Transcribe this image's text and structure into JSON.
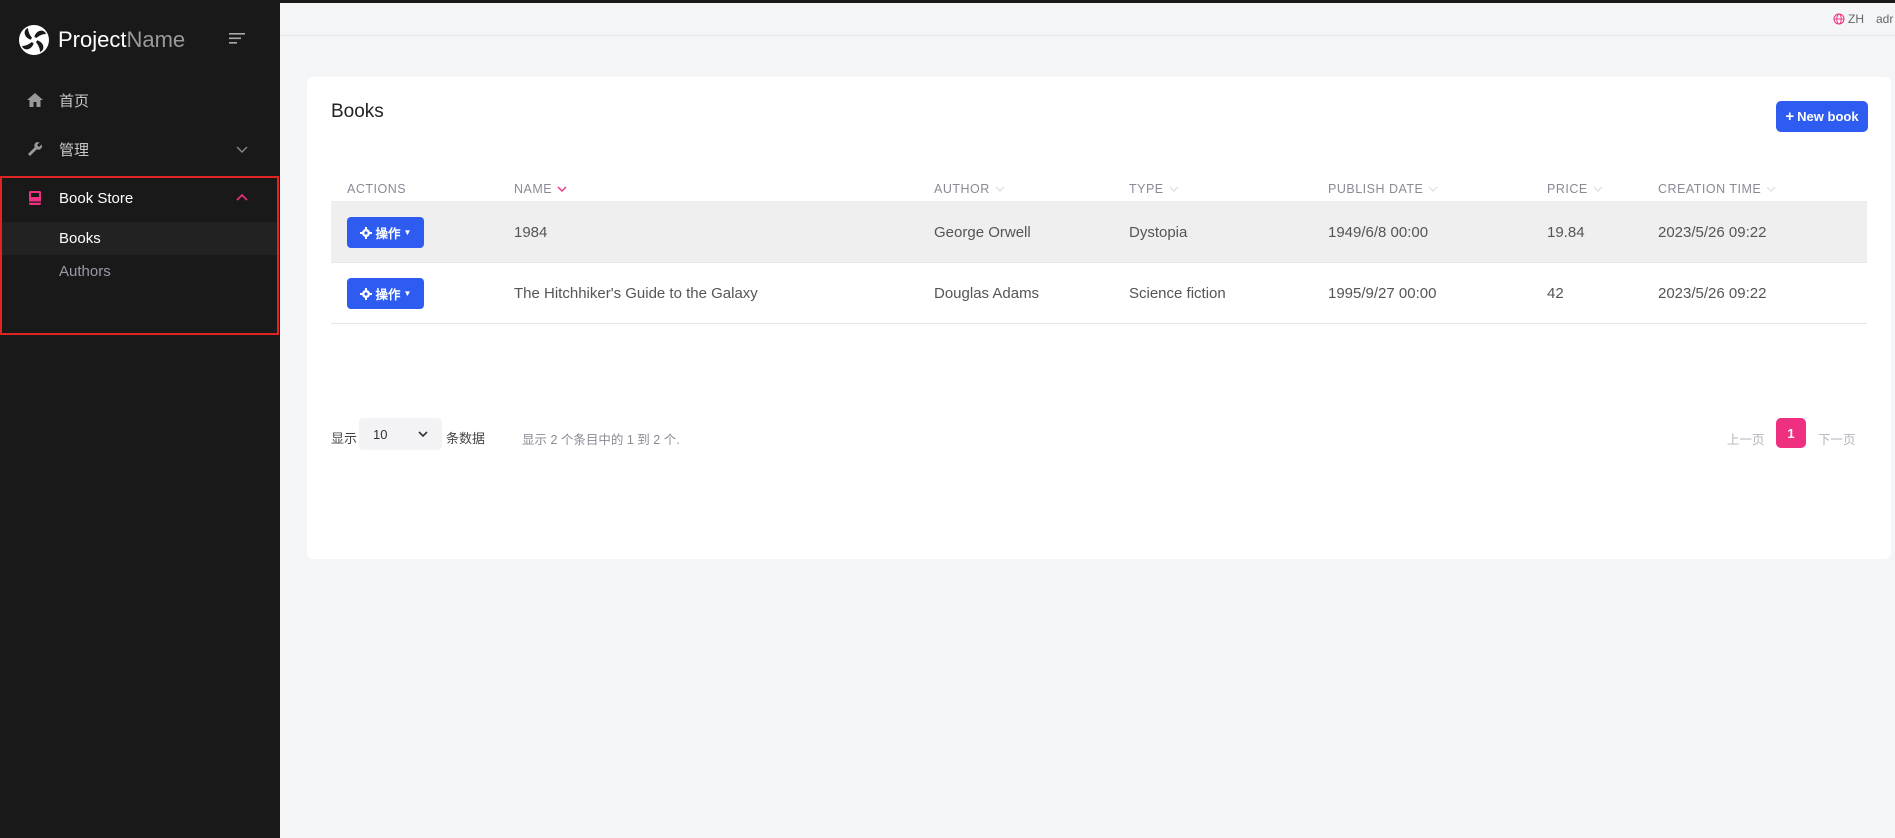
{
  "brand": {
    "name_bold": "Project",
    "name_light": "Name"
  },
  "sidebar": {
    "items": [
      {
        "label": "首页",
        "icon": "home-icon"
      },
      {
        "label": "管理",
        "icon": "wrench-icon"
      },
      {
        "label": "Book Store",
        "icon": "book-icon"
      }
    ],
    "submenu": [
      {
        "label": "Books"
      },
      {
        "label": "Authors"
      }
    ]
  },
  "topbar": {
    "language": "ZH",
    "user": "adr"
  },
  "page": {
    "title": "Books",
    "new_button": "New book"
  },
  "table": {
    "columns": [
      "ACTIONS",
      "NAME",
      "AUTHOR",
      "TYPE",
      "PUBLISH DATE",
      "PRICE",
      "CREATION TIME"
    ],
    "action_label": "操作",
    "rows": [
      {
        "name": "1984",
        "author": "George Orwell",
        "type": "Dystopia",
        "publish_date": "1949/6/8 00:00",
        "price": "19.84",
        "creation_time": "2023/5/26 09:22"
      },
      {
        "name": "The Hitchhiker's Guide to the Galaxy",
        "author": "Douglas Adams",
        "type": "Science fiction",
        "publish_date": "1995/9/27 00:00",
        "price": "42",
        "creation_time": "2023/5/26 09:22"
      }
    ]
  },
  "footer": {
    "show_label": "显示",
    "page_size": "10",
    "entries_label": "条数据",
    "info": "显示 2 个条目中的 1 到 2 个.",
    "prev": "上一页",
    "current_page": "1",
    "next": "下一页"
  },
  "colors": {
    "primary": "#2f5cf0",
    "accent": "#ef2f7f",
    "sidebar_bg": "#191919"
  }
}
